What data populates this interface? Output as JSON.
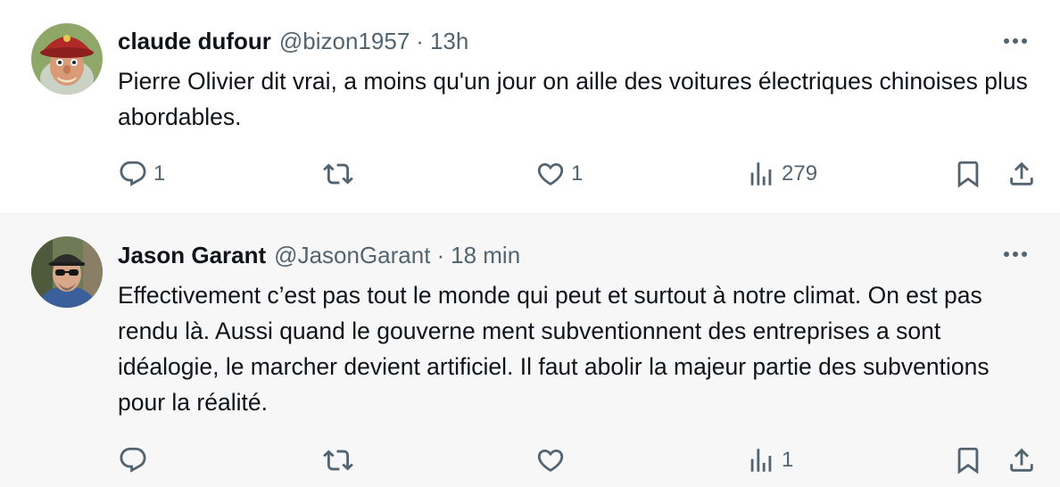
{
  "tweets": [
    {
      "display_name": "claude dufour",
      "handle": "@bizon1957",
      "separator": "·",
      "time": "13h",
      "text": "Pierre Olivier dit vrai, a moins qu'un jour on aille des voitures électriques chinoises plus abordables.",
      "avatar_icon": "avatar-hat-caricature",
      "actions": {
        "replies": "1",
        "retweets": "",
        "likes": "1",
        "views": "279"
      }
    },
    {
      "display_name": "Jason Garant",
      "handle": "@JasonGarant",
      "separator": "·",
      "time": "18 min",
      "text": "Effectivement c’est pas tout le monde qui peut et surtout à notre climat. On est pas rendu là. Aussi quand le gouverne ment subventionnent des entreprises a sont idéalogie, le marcher devient artificiel. Il faut abolir la majeur partie des subventions pour la réalité.",
      "avatar_icon": "avatar-photo-man-cap-sunglasses",
      "actions": {
        "replies": "",
        "retweets": "",
        "likes": "",
        "views": "1"
      }
    }
  ],
  "icons": {
    "reply": "reply-icon",
    "retweet": "retweet-icon",
    "like": "heart-icon",
    "views": "views-icon",
    "bookmark": "bookmark-icon",
    "share": "share-icon",
    "more": "more-icon"
  },
  "colors": {
    "text_primary": "#0f1419",
    "text_secondary": "#536471",
    "highlight_background": "#f7f7f7"
  }
}
